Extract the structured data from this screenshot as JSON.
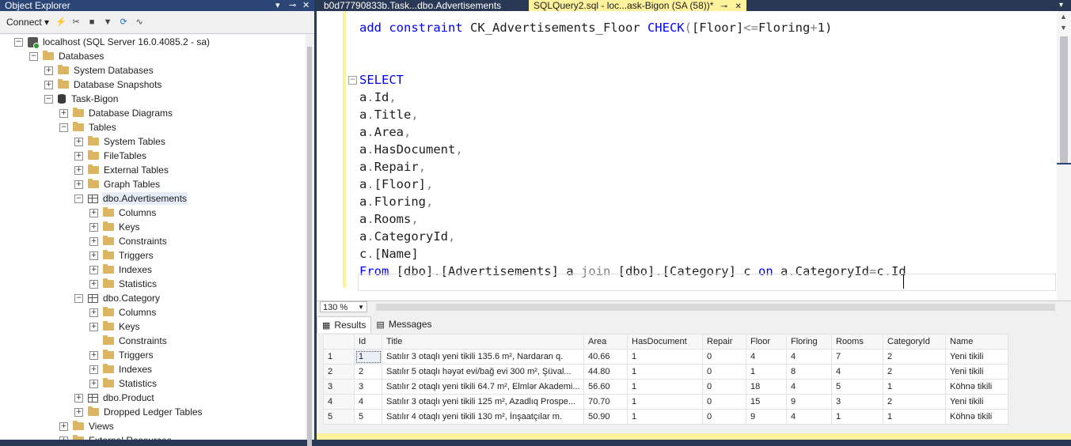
{
  "object_explorer": {
    "title": "Object Explorer",
    "title_controls": [
      "▾",
      "⊸",
      "✕"
    ],
    "toolbar": {
      "connect_label": "Connect ▾"
    },
    "tree": [
      {
        "label": "localhost (SQL Server 16.0.4085.2 - sa)",
        "level": 0,
        "expander": "−",
        "icon": "server-icon"
      },
      {
        "label": "Databases",
        "level": 1,
        "expander": "−",
        "icon": "folder-icon"
      },
      {
        "label": "System Databases",
        "level": 2,
        "expander": "+",
        "icon": "folder-icon"
      },
      {
        "label": "Database Snapshots",
        "level": 2,
        "expander": "+",
        "icon": "folder-icon"
      },
      {
        "label": "Task-Bigon",
        "level": 2,
        "expander": "−",
        "icon": "database-icon"
      },
      {
        "label": "Database Diagrams",
        "level": 3,
        "expander": "+",
        "icon": "folder-icon"
      },
      {
        "label": "Tables",
        "level": 3,
        "expander": "−",
        "icon": "folder-icon"
      },
      {
        "label": "System Tables",
        "level": 4,
        "expander": "+",
        "icon": "folder-icon"
      },
      {
        "label": "FileTables",
        "level": 4,
        "expander": "+",
        "icon": "folder-icon"
      },
      {
        "label": "External Tables",
        "level": 4,
        "expander": "+",
        "icon": "folder-icon"
      },
      {
        "label": "Graph Tables",
        "level": 4,
        "expander": "+",
        "icon": "folder-icon"
      },
      {
        "label": "dbo.Advertisements",
        "level": 4,
        "expander": "−",
        "icon": "table-icon",
        "selected": true
      },
      {
        "label": "Columns",
        "level": 5,
        "expander": "+",
        "icon": "folder-icon"
      },
      {
        "label": "Keys",
        "level": 5,
        "expander": "+",
        "icon": "folder-icon"
      },
      {
        "label": "Constraints",
        "level": 5,
        "expander": "+",
        "icon": "folder-icon"
      },
      {
        "label": "Triggers",
        "level": 5,
        "expander": "+",
        "icon": "folder-icon"
      },
      {
        "label": "Indexes",
        "level": 5,
        "expander": "+",
        "icon": "folder-icon"
      },
      {
        "label": "Statistics",
        "level": 5,
        "expander": "+",
        "icon": "folder-icon"
      },
      {
        "label": "dbo.Category",
        "level": 4,
        "expander": "−",
        "icon": "table-icon"
      },
      {
        "label": "Columns",
        "level": 5,
        "expander": "+",
        "icon": "folder-icon"
      },
      {
        "label": "Keys",
        "level": 5,
        "expander": "+",
        "icon": "folder-icon"
      },
      {
        "label": "Constraints",
        "level": 5,
        "expander": "",
        "icon": "folder-icon"
      },
      {
        "label": "Triggers",
        "level": 5,
        "expander": "+",
        "icon": "folder-icon"
      },
      {
        "label": "Indexes",
        "level": 5,
        "expander": "+",
        "icon": "folder-icon"
      },
      {
        "label": "Statistics",
        "level": 5,
        "expander": "+",
        "icon": "folder-icon"
      },
      {
        "label": "dbo.Product",
        "level": 4,
        "expander": "+",
        "icon": "table-icon"
      },
      {
        "label": "Dropped Ledger Tables",
        "level": 4,
        "expander": "+",
        "icon": "folder-icon"
      },
      {
        "label": "Views",
        "level": 3,
        "expander": "+",
        "icon": "folder-icon"
      },
      {
        "label": "External Resources",
        "level": 3,
        "expander": "+",
        "icon": "folder-icon"
      }
    ]
  },
  "tabs": [
    {
      "label": "b0d77790833b.Task...dbo.Advertisements",
      "active": false
    },
    {
      "label": "SQLQuery2.sql - loc...ask-Bigon (SA (58))*",
      "active": true,
      "pin": "⊸",
      "close": "✕"
    }
  ],
  "editor": {
    "lines": [
      [
        {
          "t": "add constraint",
          "c": "kw"
        },
        {
          "t": " CK_Advertisements_Floor ",
          "c": ""
        },
        {
          "t": "CHECK",
          "c": "kw"
        },
        {
          "t": "(",
          "c": "gray"
        },
        {
          "t": "[Floor]",
          "c": ""
        },
        {
          "t": "<=",
          "c": "gray"
        },
        {
          "t": "Floring",
          "c": ""
        },
        {
          "t": "+",
          "c": "gray"
        },
        {
          "t": "1)",
          "c": ""
        }
      ],
      [],
      [],
      [
        {
          "t": "SELECT",
          "c": "kw"
        }
      ],
      [
        {
          "t": "a",
          "c": ""
        },
        {
          "t": ".",
          "c": "gray"
        },
        {
          "t": "Id",
          "c": ""
        },
        {
          "t": ",",
          "c": "gray"
        }
      ],
      [
        {
          "t": "a",
          "c": ""
        },
        {
          "t": ".",
          "c": "gray"
        },
        {
          "t": "Title",
          "c": ""
        },
        {
          "t": ",",
          "c": "gray"
        }
      ],
      [
        {
          "t": "a",
          "c": ""
        },
        {
          "t": ".",
          "c": "gray"
        },
        {
          "t": "Area",
          "c": ""
        },
        {
          "t": ",",
          "c": "gray"
        }
      ],
      [
        {
          "t": "a",
          "c": ""
        },
        {
          "t": ".",
          "c": "gray"
        },
        {
          "t": "HasDocument",
          "c": ""
        },
        {
          "t": ",",
          "c": "gray"
        }
      ],
      [
        {
          "t": "a",
          "c": ""
        },
        {
          "t": ".",
          "c": "gray"
        },
        {
          "t": "Repair",
          "c": ""
        },
        {
          "t": ",",
          "c": "gray"
        }
      ],
      [
        {
          "t": "a",
          "c": ""
        },
        {
          "t": ".",
          "c": "gray"
        },
        {
          "t": "[Floor]",
          "c": ""
        },
        {
          "t": ",",
          "c": "gray"
        }
      ],
      [
        {
          "t": "a",
          "c": ""
        },
        {
          "t": ".",
          "c": "gray"
        },
        {
          "t": "Floring",
          "c": ""
        },
        {
          "t": ",",
          "c": "gray"
        }
      ],
      [
        {
          "t": "a",
          "c": ""
        },
        {
          "t": ".",
          "c": "gray"
        },
        {
          "t": "Rooms",
          "c": ""
        },
        {
          "t": ",",
          "c": "gray"
        }
      ],
      [
        {
          "t": "a",
          "c": ""
        },
        {
          "t": ".",
          "c": "gray"
        },
        {
          "t": "CategoryId",
          "c": ""
        },
        {
          "t": ",",
          "c": "gray"
        }
      ],
      [
        {
          "t": "c",
          "c": ""
        },
        {
          "t": ".",
          "c": "gray"
        },
        {
          "t": "[Name]",
          "c": ""
        }
      ],
      [
        {
          "t": "From",
          "c": "kw"
        },
        {
          "t": " [dbo]",
          "c": ""
        },
        {
          "t": ".",
          "c": "gray"
        },
        {
          "t": "[Advertisements] a ",
          "c": ""
        },
        {
          "t": "join",
          "c": "gray"
        },
        {
          "t": " [dbo]",
          "c": ""
        },
        {
          "t": ".",
          "c": "gray"
        },
        {
          "t": "[Category] c ",
          "c": ""
        },
        {
          "t": "on",
          "c": "kw"
        },
        {
          "t": " a",
          "c": ""
        },
        {
          "t": ".",
          "c": "gray"
        },
        {
          "t": "CategoryId",
          "c": ""
        },
        {
          "t": "=",
          "c": "gray"
        },
        {
          "t": "c",
          "c": ""
        },
        {
          "t": ".",
          "c": "gray"
        },
        {
          "t": "Id",
          "c": ""
        }
      ]
    ]
  },
  "zoom": {
    "value": "130 %"
  },
  "results": {
    "tabs": [
      {
        "label": "Results",
        "icon": "grid-icon"
      },
      {
        "label": "Messages",
        "icon": "messages-icon"
      }
    ],
    "columns": [
      "Id",
      "Title",
      "Area",
      "HasDocument",
      "Repair",
      "Floor",
      "Floring",
      "Rooms",
      "CategoryId",
      "Name"
    ],
    "rows": [
      [
        "1",
        "1",
        "Satılır 3 otaqlı yeni tikili 135.6 m², Nardaran q.",
        "40.66",
        "1",
        "0",
        "4",
        "4",
        "7",
        "2",
        "Yeni tikili"
      ],
      [
        "2",
        "2",
        "Satılır 5 otaqlı həyət evi/bağ evi 300 m², Şüval...",
        "44.80",
        "1",
        "0",
        "1",
        "8",
        "4",
        "2",
        "Yeni tikili"
      ],
      [
        "3",
        "3",
        "Satılır 2 otaqlı yeni tikili 64.7 m², Elmlər Akademi...",
        "56.60",
        "1",
        "0",
        "18",
        "4",
        "5",
        "1",
        "Köhnə tikili"
      ],
      [
        "4",
        "4",
        "Satılır 3 otaqlı yeni tikili 125 m², Azadlıq Prospe...",
        "70.70",
        "1",
        "0",
        "15",
        "9",
        "3",
        "2",
        "Yeni tikili"
      ],
      [
        "5",
        "5",
        "Satılır 4 otaqlı yeni tikili 130 m², İnşaatçılar m.",
        "50.90",
        "1",
        "0",
        "9",
        "4",
        "1",
        "1",
        "Köhnə tikili"
      ]
    ]
  }
}
